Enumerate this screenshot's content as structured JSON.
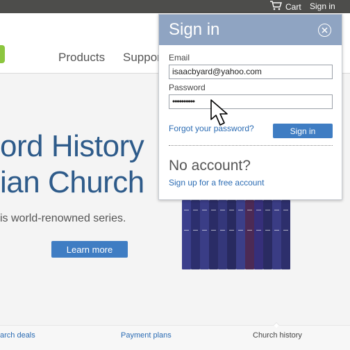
{
  "topbar": {
    "cart_label": "Cart",
    "signin_label": "Sign in",
    "cart_icon": "shopping-cart-icon"
  },
  "nav": {
    "items": [
      "Products",
      "Suppor"
    ]
  },
  "hero": {
    "title_line1": "ord History",
    "title_line2": "ian Church",
    "subtitle": "is world-renowned series.",
    "button_label": "Learn more"
  },
  "bottom_links": [
    "arch deals",
    "Payment plans",
    "Church history"
  ],
  "signin_popup": {
    "title": "Sign in",
    "close_icon": "close-circle-icon",
    "email_label": "Email",
    "email_value": "isaacbyard@yahoo.com",
    "password_label": "Password",
    "password_value": "••••••••••",
    "forgot_link": "Forgot your password?",
    "signin_button": "Sign in",
    "no_account_heading": "No account?",
    "signup_link": "Sign up for a free account"
  },
  "colors": {
    "accent_blue": "#3f7dc3",
    "popup_header": "#8fa4c2",
    "hero_title": "#2e5b8a",
    "topbar": "#4d4d4b"
  }
}
